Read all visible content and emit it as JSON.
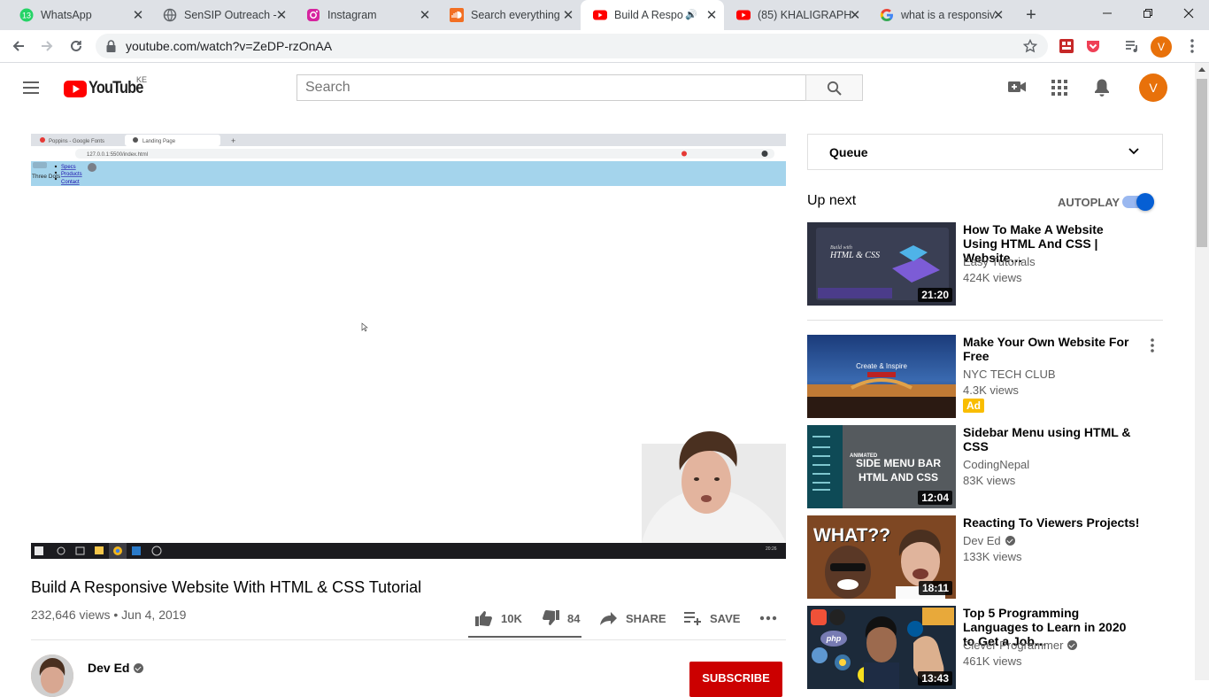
{
  "browser": {
    "tabs": [
      {
        "title": "WhatsApp",
        "badge": "13"
      },
      {
        "title": "SenSIP Outreach -"
      },
      {
        "title": "Instagram"
      },
      {
        "title": "Search everything"
      },
      {
        "title": "Build A Respo"
      },
      {
        "title": "(85) KHALIGRAPH"
      },
      {
        "title": "what is a responsiv"
      }
    ],
    "url": "youtube.com/watch?v=ZeDP-rzOnAA",
    "profile_initial": "V"
  },
  "youtube": {
    "logo_text": "YouTube",
    "region": "KE",
    "search_placeholder": "Search",
    "avatar_initial": "V"
  },
  "video": {
    "title": "Build A Responsive Website With HTML & CSS Tutorial",
    "views_date": "232,646 views • Jun 4, 2019",
    "likes": "10K",
    "dislikes": "84",
    "share_label": "SHARE",
    "save_label": "SAVE",
    "channel": "Dev Ed",
    "subscribe_label": "SUBSCRIBE",
    "inner_page": {
      "tabs": [
        "Poppins - Google Fonts",
        "Landing Page"
      ],
      "url": "127.0.0.1:5500/index.html",
      "logo": "Three Dots",
      "nav": [
        "Specs",
        "Products",
        "Contact"
      ]
    }
  },
  "sidebar": {
    "queue_label": "Queue",
    "up_next": "Up next",
    "autoplay": "AUTOPLAY",
    "autoplay_on": true,
    "items": [
      {
        "title": "How To Make A Website Using HTML And CSS | Website…",
        "channel": "Easy Tutorials",
        "views": "424K views",
        "duration": "21:20",
        "thumb_text": "HTML & CSS"
      },
      {
        "title": "Make Your Own Website For Free",
        "channel": "NYC TECH CLUB",
        "views": "4.3K views",
        "badge": "Ad",
        "thumb_text": "Create & Inspire"
      },
      {
        "title": "Sidebar Menu using HTML & CSS",
        "channel": "CodingNepal",
        "views": "83K views",
        "duration": "12:04",
        "thumb_text": "SIDE MENU BAR HTML AND CSS"
      },
      {
        "title": "Reacting To Viewers Projects!",
        "channel": "Dev Ed",
        "views": "133K views",
        "duration": "18:11",
        "thumb_text": "WHAT??"
      },
      {
        "title": "Top 5 Programming Languages to Learn in 2020 to Get a Job…",
        "channel": "Clever Programmer",
        "views": "461K views",
        "duration": "13:43"
      }
    ]
  }
}
